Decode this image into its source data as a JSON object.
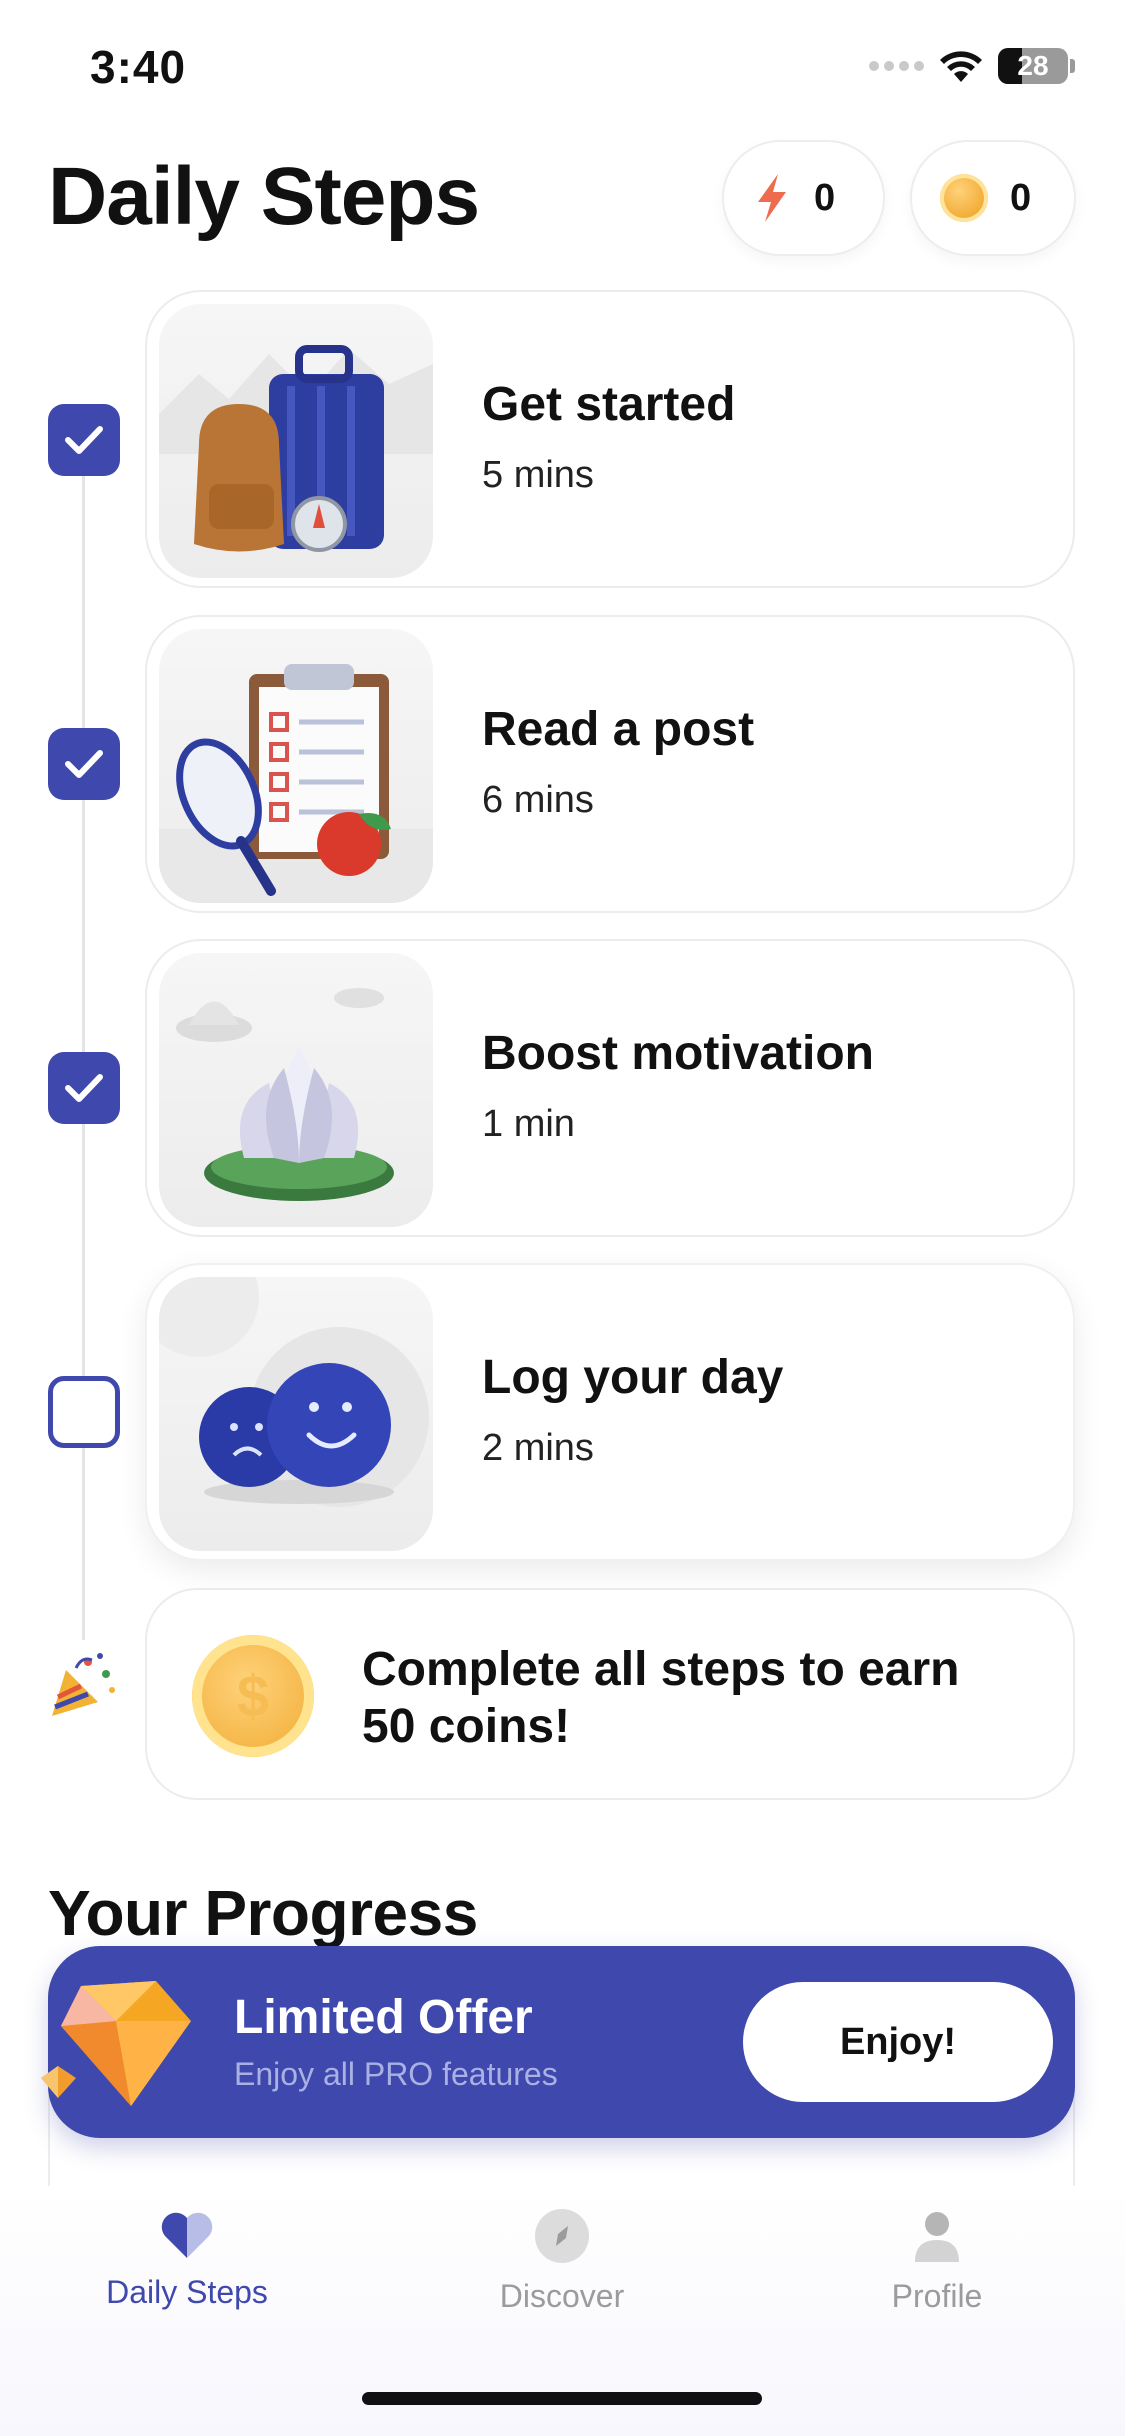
{
  "status_bar": {
    "time": "3:40",
    "battery": "28"
  },
  "header": {
    "title": "Daily Steps",
    "energy_count": "0",
    "coin_count": "0"
  },
  "steps": [
    {
      "title": "Get started",
      "duration": "5 mins",
      "completed": true,
      "illustration": "travel-bags-icon"
    },
    {
      "title": "Read a post",
      "duration": "6 mins",
      "completed": true,
      "illustration": "clipboard-checklist-icon"
    },
    {
      "title": "Boost motivation",
      "duration": "1 min",
      "completed": true,
      "illustration": "lotus-flower-icon"
    },
    {
      "title": "Log your day",
      "duration": "2 mins",
      "completed": false,
      "illustration": "mood-faces-icon"
    }
  ],
  "reward": {
    "text": "Complete all steps to earn 50 coins!",
    "coin_symbol": "$"
  },
  "progress": {
    "title": "Your Progress"
  },
  "banner": {
    "title": "Limited Offer",
    "subtitle": "Enjoy all PRO features",
    "button_label": "Enjoy!"
  },
  "tabs": [
    {
      "label": "Daily Steps",
      "icon": "heart-icon",
      "active": true
    },
    {
      "label": "Discover",
      "icon": "compass-icon",
      "active": false
    },
    {
      "label": "Profile",
      "icon": "person-icon",
      "active": false
    }
  ],
  "colors": {
    "accent": "#3f48ad",
    "coin": "#f4b443",
    "energy": "#ef6b4d"
  }
}
